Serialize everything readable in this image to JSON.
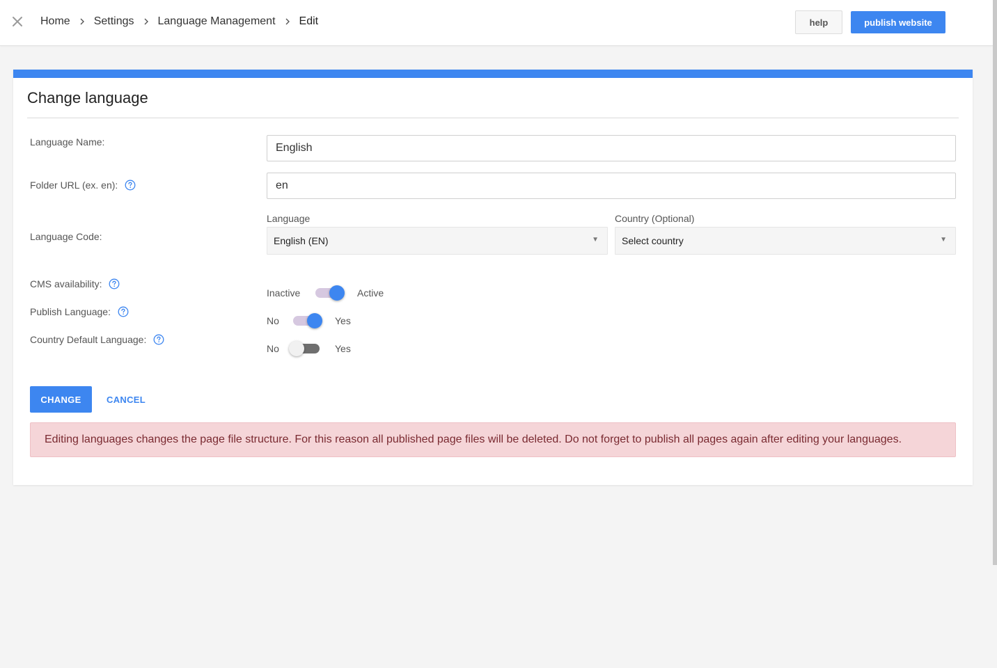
{
  "header": {
    "breadcrumb": [
      {
        "label": "Home"
      },
      {
        "label": "Settings"
      },
      {
        "label": "Language Management"
      },
      {
        "label": "Edit"
      }
    ],
    "help_label": "help",
    "publish_label": "publish website"
  },
  "form": {
    "title": "Change language",
    "language_name": {
      "label": "Language Name:",
      "value": "English"
    },
    "folder_url": {
      "label": "Folder URL (ex. en):",
      "value": "en"
    },
    "language_code": {
      "label": "Language Code:",
      "language_label": "Language",
      "language_value": "English (EN)",
      "country_label": "Country (Optional)",
      "country_value": "Select country"
    },
    "cms_availability": {
      "label": "CMS availability:",
      "off_text": "Inactive",
      "on_text": "Active",
      "state": "on"
    },
    "publish_language": {
      "label": "Publish Language:",
      "off_text": "No",
      "on_text": "Yes",
      "state": "on"
    },
    "country_default": {
      "label": "Country Default Language:",
      "off_text": "No",
      "on_text": "Yes",
      "state": "off"
    },
    "change_label": "CHANGE",
    "cancel_label": "CANCEL",
    "alert": "Editing languages changes the page file structure. For this reason all published page files will be deleted. Do not forget to publish all pages again after editing your languages."
  },
  "colors": {
    "accent": "#3d86f0",
    "alert_bg": "#f5d5d8",
    "alert_text": "#7a2a31"
  }
}
